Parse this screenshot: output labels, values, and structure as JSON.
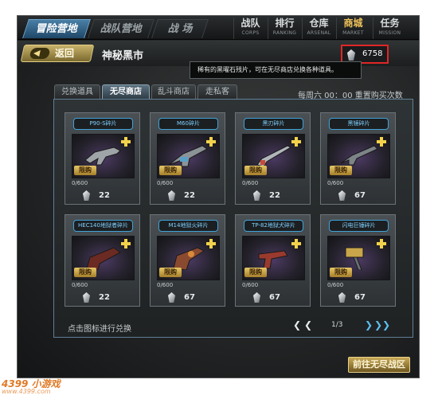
{
  "main_tabs": [
    {
      "label": "冒险营地",
      "active": true
    },
    {
      "label": "战队营地",
      "active": false
    },
    {
      "label": "战 场",
      "active": false
    }
  ],
  "nav": [
    {
      "label": "战队",
      "sub": "CORPS",
      "active": false
    },
    {
      "label": "排行",
      "sub": "RANKING",
      "active": false
    },
    {
      "label": "仓库",
      "sub": "ARSENAL",
      "active": false
    },
    {
      "label": "商城",
      "sub": "MARKET",
      "active": true
    },
    {
      "label": "任务",
      "sub": "MISSION",
      "active": false
    }
  ],
  "subheader": {
    "back_label": "返回",
    "title": "神秘黑市"
  },
  "currency": {
    "value": "6758",
    "icon": "crystal-shard-icon"
  },
  "tooltip": "稀有的黑曜石残片，可在无尽商店兑换各种道具。",
  "shop_tabs": [
    {
      "label": "兑换道具",
      "active": false
    },
    {
      "label": "无尽商店",
      "active": true
    },
    {
      "label": "乱斗商店",
      "active": false
    },
    {
      "label": "走私客",
      "active": false
    }
  ],
  "reset_info": "每周六 00：00 重置购买次数",
  "items": [
    {
      "name": "P90-S碎片",
      "limit": "限购",
      "count": "0/600",
      "price": "22",
      "weapon": "smg-icon"
    },
    {
      "name": "M60碎片",
      "limit": "限购",
      "count": "0/600",
      "price": "22",
      "weapon": "machine-gun-icon"
    },
    {
      "name": "黑刃碎片",
      "limit": "限购",
      "count": "0/600",
      "price": "22",
      "weapon": "blade-icon"
    },
    {
      "name": "黑镜碎片",
      "limit": "限购",
      "count": "0/600",
      "price": "67",
      "weapon": "rifle-icon"
    },
    {
      "name": "HEC140地狱者碎片",
      "limit": "限购",
      "count": "0/600",
      "price": "22",
      "weapon": "shotgun-icon"
    },
    {
      "name": "M14地狱火碎片",
      "limit": "限购",
      "count": "0/600",
      "price": "67",
      "weapon": "grenade-launcher-icon"
    },
    {
      "name": "TP-82地狱犬碎片",
      "limit": "限购",
      "count": "0/600",
      "price": "67",
      "weapon": "pistol-icon"
    },
    {
      "name": "闪电巨锤碎片",
      "limit": "限购",
      "count": "0/600",
      "price": "67",
      "weapon": "hammer-icon"
    }
  ],
  "footer": {
    "hint": "点击图标进行兑换",
    "page": "1/3",
    "first_label": "❮",
    "prev_label": "❮",
    "next_label": "❯",
    "last_label": "❯❯",
    "goto_label": "前往无尽战区"
  },
  "watermark": {
    "text": "4399 小游戏",
    "sub": "www.4399.com"
  },
  "colors": {
    "accent_blue": "#41a3d8",
    "gold": "#e7c766",
    "highlight_red": "#e02626"
  }
}
